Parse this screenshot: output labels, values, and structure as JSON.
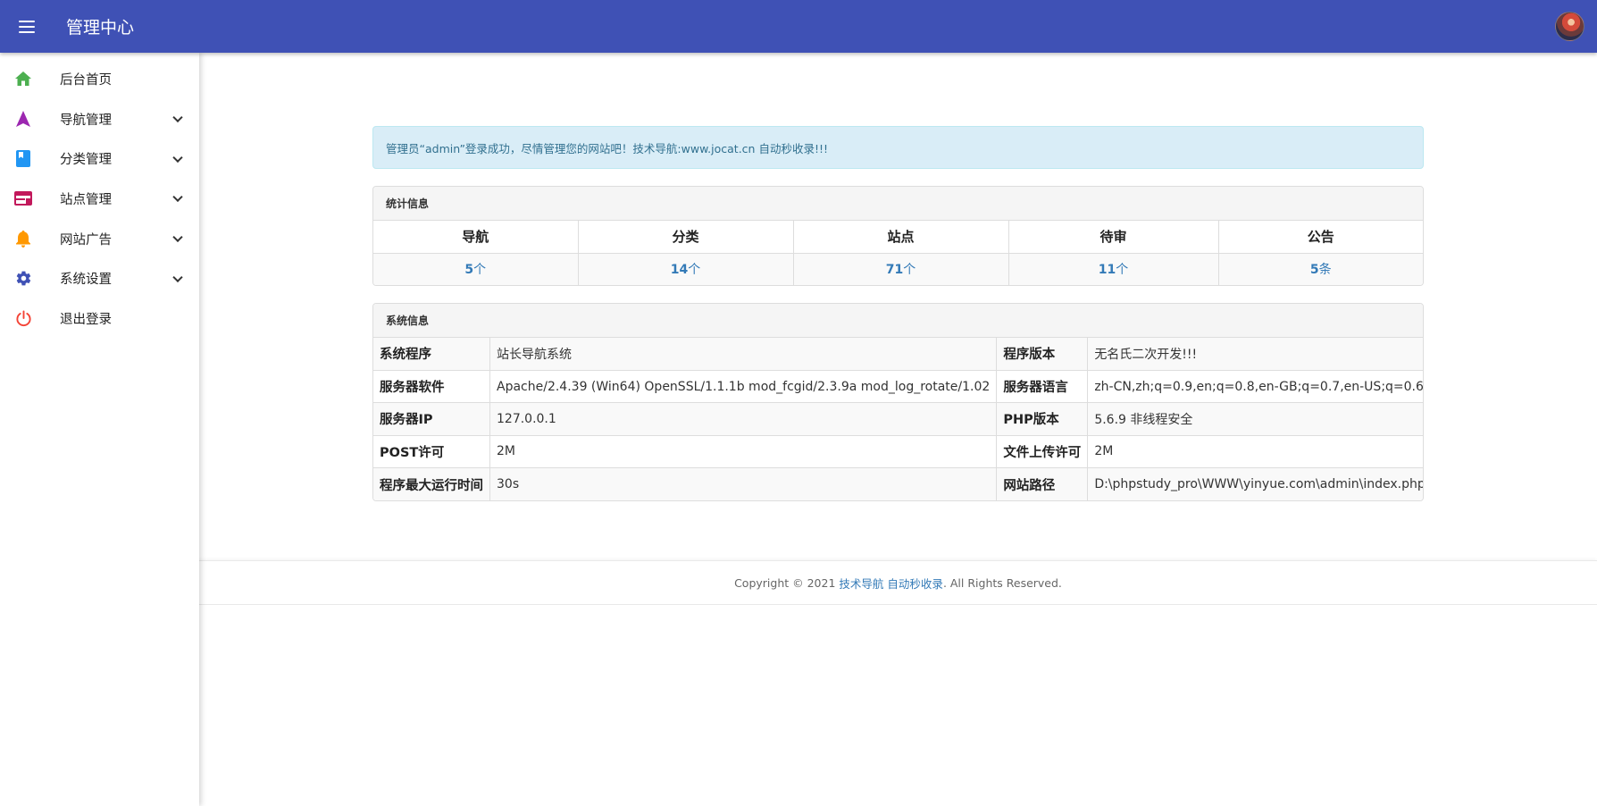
{
  "header": {
    "title": "管理中心",
    "menu_icon": "menu-icon",
    "avatar": "user-avatar",
    "bar_color": "#3f51b5"
  },
  "sidebar": {
    "items": [
      {
        "label": "后台首页",
        "icon": "home-icon",
        "color": "#4caf50",
        "expandable": false
      },
      {
        "label": "导航管理",
        "icon": "navigation-icon",
        "color": "#9c27b0",
        "expandable": true
      },
      {
        "label": "分类管理",
        "icon": "book-icon",
        "color": "#2196f3",
        "expandable": true
      },
      {
        "label": "站点管理",
        "icon": "web-icon",
        "color": "#c2185b",
        "expandable": true
      },
      {
        "label": "网站广告",
        "icon": "bell-icon",
        "color": "#ff9800",
        "expandable": true
      },
      {
        "label": "系统设置",
        "icon": "gear-icon",
        "color": "#3f51b5",
        "expandable": true
      },
      {
        "label": "退出登录",
        "icon": "power-icon",
        "color": "#f44336",
        "expandable": false
      }
    ]
  },
  "alert": {
    "text": "管理员“admin”登录成功，尽情管理您的网站吧！技术导航:www.jocat.cn 自动秒收录!!!"
  },
  "stats": {
    "title": "统计信息",
    "columns": [
      {
        "header": "导航",
        "value": "5",
        "unit": "个"
      },
      {
        "header": "分类",
        "value": "14",
        "unit": "个"
      },
      {
        "header": "站点",
        "value": "71",
        "unit": "个"
      },
      {
        "header": "待审",
        "value": "11",
        "unit": "个"
      },
      {
        "header": "公告",
        "value": "5",
        "unit": "条"
      }
    ]
  },
  "system": {
    "title": "系统信息",
    "rows": [
      [
        "系统程序",
        "站长导航系统",
        "程序版本",
        "无名氏二次开发!!!"
      ],
      [
        "服务器软件",
        "Apache/2.4.39 (Win64) OpenSSL/1.1.1b mod_fcgid/2.3.9a mod_log_rotate/1.02",
        "服务器语言",
        "zh-CN,zh;q=0.9,en;q=0.8,en-GB;q=0.7,en-US;q=0.6"
      ],
      [
        "服务器IP",
        "127.0.0.1",
        "PHP版本",
        "5.6.9 非线程安全"
      ],
      [
        "POST许可",
        "2M",
        "文件上传许可",
        "2M"
      ],
      [
        "程序最大运行时间",
        "30s",
        "网站路径",
        "D:\\phpstudy_pro\\WWW\\yinyue.com\\admin\\index.php"
      ]
    ]
  },
  "footer": {
    "prefix": "Copyright © 2021",
    "link1": "技术导航",
    "link2": "自动秒收录",
    "suffix": ". All Rights Reserved."
  }
}
